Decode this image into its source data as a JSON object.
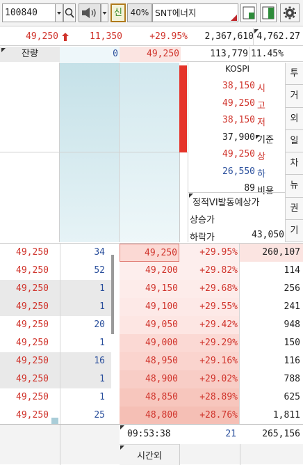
{
  "toolbar": {
    "stock_code": "100840",
    "credit_label": "신",
    "margin_rate": "40%",
    "stock_name": "SNT에너지"
  },
  "summary": {
    "price": "49,250",
    "change": "11,350",
    "change_rate": "+29.95%",
    "volume": "2,367,610",
    "index_value": "4,762.27"
  },
  "remain": {
    "label": "잔량",
    "ask_total": "0",
    "price": "49,250",
    "bid_total": "113,779",
    "ratio": "11.45%"
  },
  "info": {
    "market": "KOSPI",
    "rows": [
      {
        "value": "38,150",
        "label": "시",
        "color": "#d0342c"
      },
      {
        "value": "49,250",
        "label": "고",
        "color": "#d0342c"
      },
      {
        "value": "38,150",
        "label": "저",
        "color": "#d0342c"
      },
      {
        "value": "37,900",
        "label": "기준",
        "color": "#222222"
      },
      {
        "value": "49,250",
        "label": "상",
        "color": "#d0342c"
      },
      {
        "value": "26,550",
        "label": "하",
        "color": "#2a4f9c"
      },
      {
        "value": "89",
        "label": "비용",
        "color": "#222222"
      }
    ],
    "vi_label": "정적VI발동예상가",
    "up_label": "상승가",
    "down_label": "하락가",
    "down_value": "43,050"
  },
  "side_tabs": [
    "투",
    "거",
    "외",
    "일",
    "차",
    "뉴",
    "권",
    "기"
  ],
  "trades": [
    {
      "price": "49,250",
      "qty": "34"
    },
    {
      "price": "49,250",
      "qty": "52"
    },
    {
      "price": "49,250",
      "qty": "1"
    },
    {
      "price": "49,250",
      "qty": "1"
    },
    {
      "price": "49,250",
      "qty": "20"
    },
    {
      "price": "49,250",
      "qty": "1"
    },
    {
      "price": "49,250",
      "qty": "16"
    },
    {
      "price": "49,250",
      "qty": "1"
    },
    {
      "price": "49,250",
      "qty": "1"
    },
    {
      "price": "49,250",
      "qty": "25"
    }
  ],
  "bids": [
    {
      "price": "49,250",
      "rate": "+29.95%",
      "qty": "260,107"
    },
    {
      "price": "49,200",
      "rate": "+29.82%",
      "qty": "114"
    },
    {
      "price": "49,150",
      "rate": "+29.68%",
      "qty": "256"
    },
    {
      "price": "49,100",
      "rate": "+29.55%",
      "qty": "241"
    },
    {
      "price": "49,050",
      "rate": "+29.42%",
      "qty": "948"
    },
    {
      "price": "49,000",
      "rate": "+29.29%",
      "qty": "150"
    },
    {
      "price": "48,950",
      "rate": "+29.16%",
      "qty": "116"
    },
    {
      "price": "48,900",
      "rate": "+29.02%",
      "qty": "788"
    },
    {
      "price": "48,850",
      "rate": "+28.89%",
      "qty": "625"
    },
    {
      "price": "48,800",
      "rate": "+28.76%",
      "qty": "1,811"
    }
  ],
  "footer": {
    "time": "09:53:38",
    "ask_count": "21",
    "bid_total": "265,156",
    "after_hours_label": "시간외"
  },
  "colors": {
    "accent_red": "#d0342c",
    "accent_blue": "#2a4f9c",
    "ask_bg": "#d9edf2",
    "bid_bg": "#fbe4e1"
  }
}
